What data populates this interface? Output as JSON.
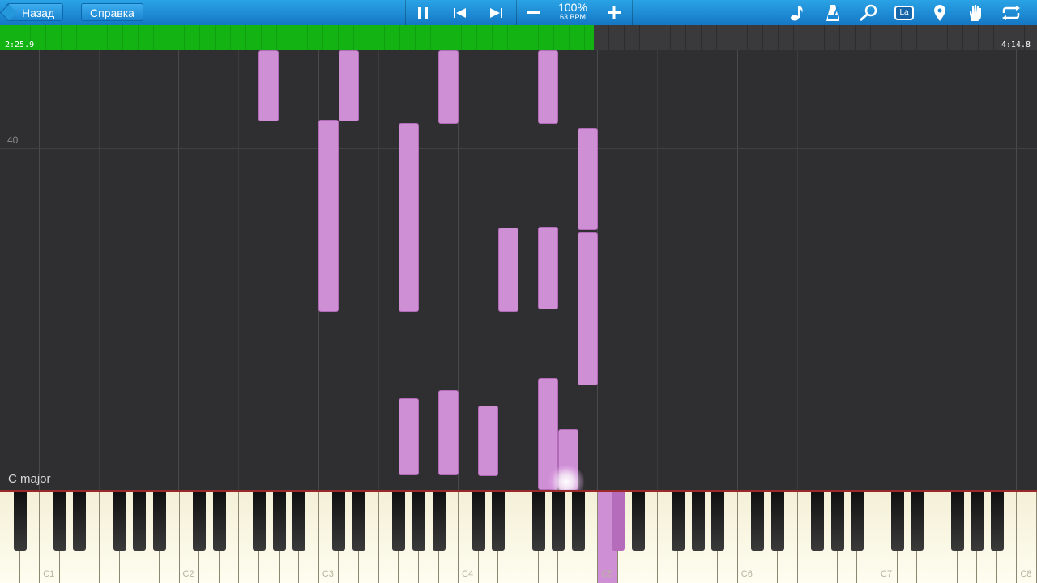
{
  "toolbar": {
    "back_label": "Назад",
    "help_label": "Справка",
    "speed_percent": "100%",
    "speed_bpm": "63 BPM",
    "label_icon_text": "La"
  },
  "progress": {
    "current_time": "2:25.9",
    "total_time": "4:14.8",
    "fraction": 0.573
  },
  "roll": {
    "measure_number": "40",
    "key_signature": "C major"
  },
  "keyboard": {
    "c_labels": [
      "C1",
      "C2",
      "C3",
      "C4",
      "C5",
      "C6",
      "C7",
      "C8"
    ],
    "pressed_keys": [
      "C#5",
      "C5"
    ]
  },
  "colors": {
    "note": "#cf8fd4",
    "progress": "#12b312",
    "toolbar": "#1a8ad6"
  },
  "icons": [
    "pause-icon",
    "previous-icon",
    "next-icon",
    "minus-icon",
    "plus-icon",
    "note-icon",
    "metronome-icon",
    "search-icon",
    "label-icon",
    "pin-icon",
    "hand-icon",
    "loop-icon"
  ]
}
